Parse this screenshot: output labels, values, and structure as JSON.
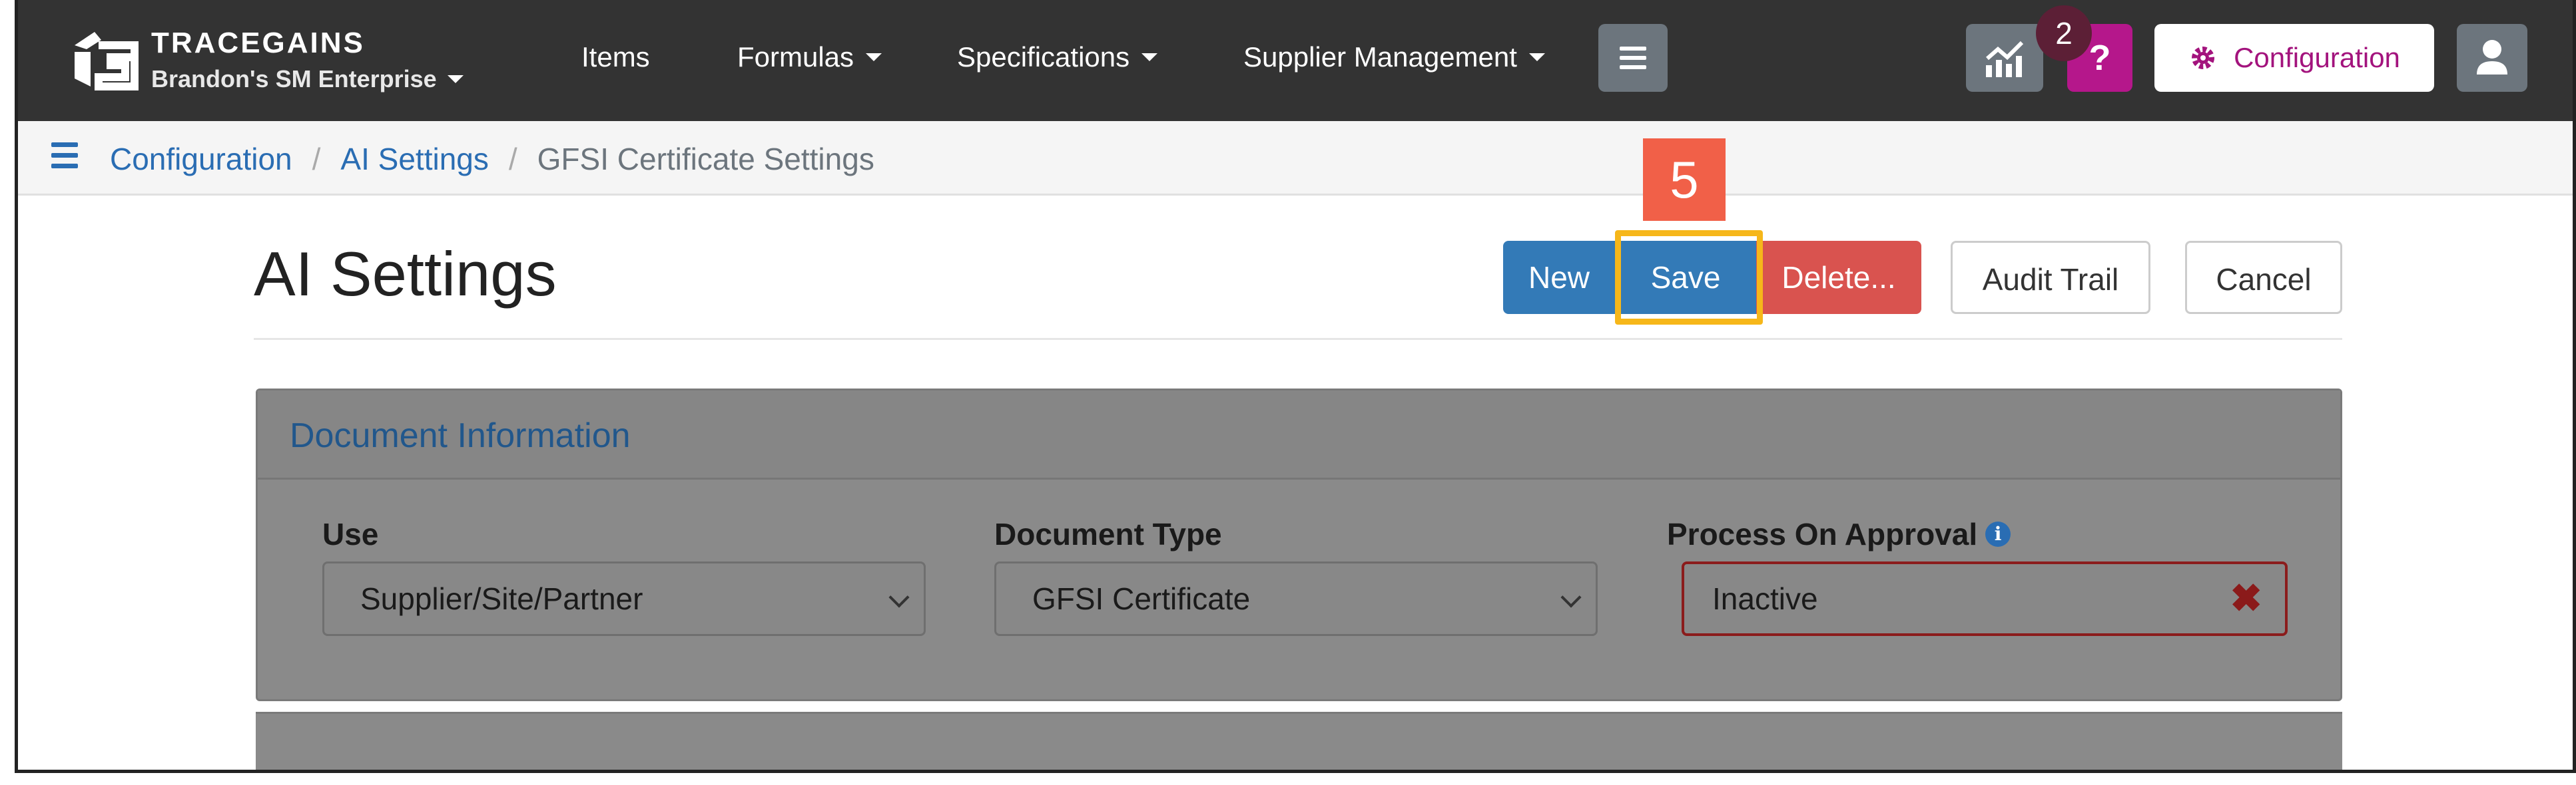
{
  "app": {
    "brand": "TRACEGAINS",
    "org": "Brandon's SM Enterprise"
  },
  "nav": {
    "items": [
      {
        "label": "Items"
      },
      {
        "label": "Formulas"
      },
      {
        "label": "Specifications"
      },
      {
        "label": "Supplier Management"
      }
    ],
    "notification_count": "2",
    "help_label": "?",
    "config_label": "Configuration"
  },
  "breadcrumb": {
    "items": [
      "Configuration",
      "AI Settings",
      "GFSI Certificate Settings"
    ],
    "separator": "/"
  },
  "page": {
    "title": "AI Settings"
  },
  "toolbar": {
    "new_label": "New",
    "save_label": "Save",
    "delete_label": "Delete...",
    "audit_label": "Audit Trail",
    "cancel_label": "Cancel"
  },
  "annotation": {
    "step_number": "5"
  },
  "panel": {
    "title": "Document Information",
    "fields": {
      "use": {
        "label": "Use",
        "value": "Supplier/Site/Partner"
      },
      "document_type": {
        "label": "Document Type",
        "value": "GFSI Certificate"
      },
      "process_on_approval": {
        "label": "Process On Approval",
        "value": "Inactive",
        "info": "i",
        "clear": "✖"
      }
    }
  },
  "colors": {
    "topbar": "#333333",
    "primary": "#337ab7",
    "danger": "#d9534f",
    "brand_magenta": "#a3137d",
    "highlight": "#f6b71a",
    "step_badge": "#f16048"
  }
}
